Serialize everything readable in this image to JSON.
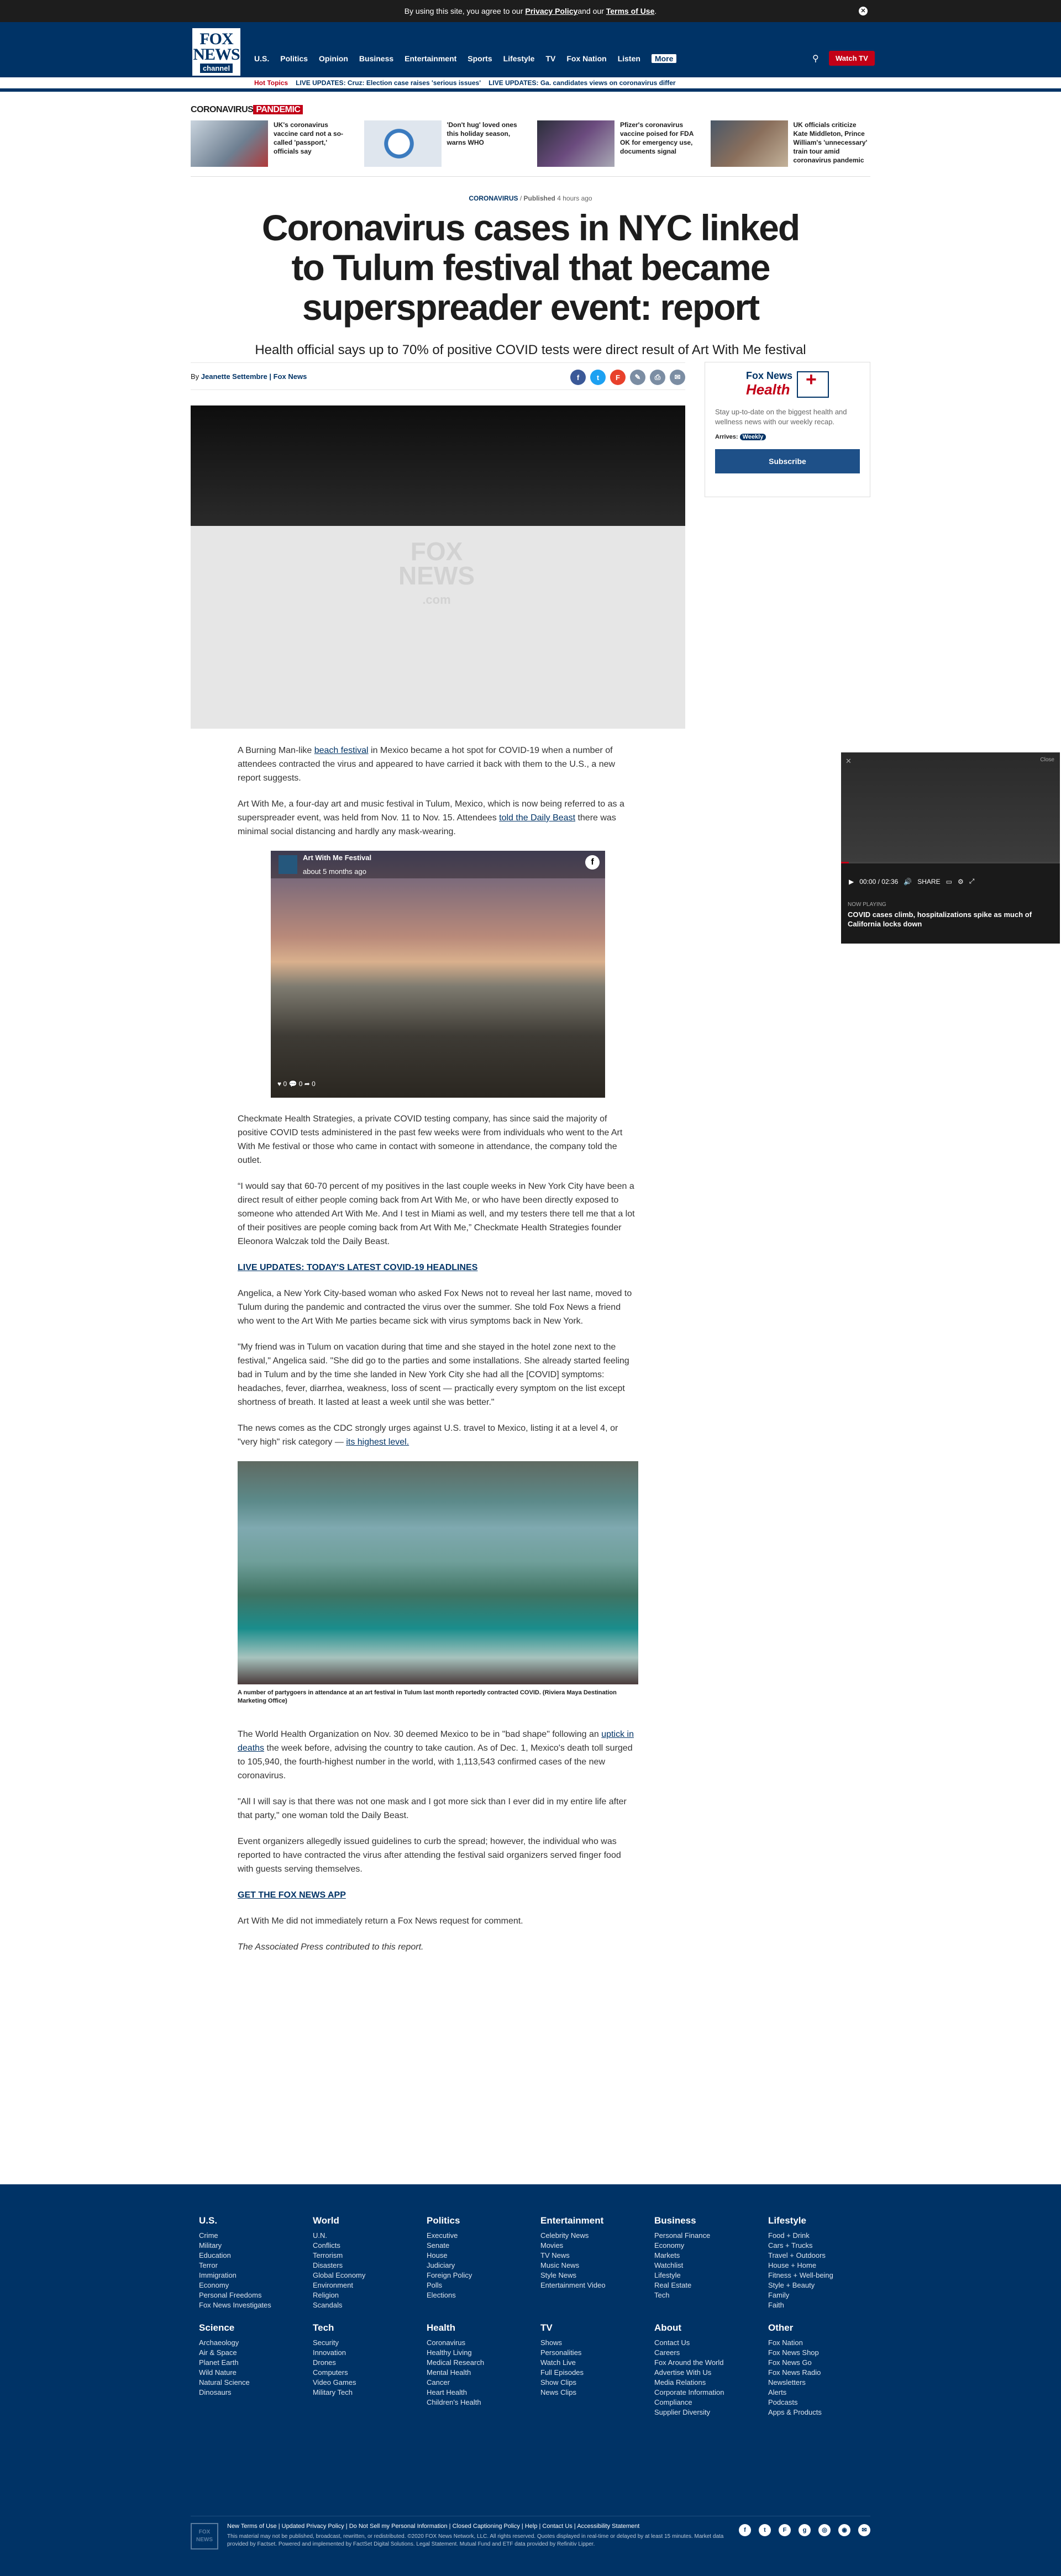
{
  "consent": {
    "prefix": "By using this site, you agree to our ",
    "privacy": "Privacy Policy",
    "and": " and our ",
    "terms": "Terms of Use",
    "dot": "."
  },
  "nav": {
    "logo_line1": "FOX",
    "logo_line2": "NEWS",
    "logo_line3": "channel",
    "items": [
      "U.S.",
      "Politics",
      "Opinion",
      "Business",
      "Entertainment",
      "Sports",
      "Lifestyle",
      "TV",
      "Fox Nation",
      "Listen",
      "More"
    ],
    "watch_tv": "Watch TV"
  },
  "hot": {
    "label": "Hot Topics",
    "h1": "LIVE UPDATES: Cruz: Election case raises 'serious issues'",
    "h2": "LIVE UPDATES: Ga. candidates views on coronavirus differ"
  },
  "topics": {
    "title": "CORONAVIRUS",
    "tag": "PANDEMIC",
    "cards": [
      {
        "text": "UK's coronavirus vaccine card not a so-called 'passport,' officials say"
      },
      {
        "text": "'Don't hug' loved ones this holiday season, warns WHO"
      },
      {
        "text": "Pfizer's coronavirus vaccine poised for FDA OK for emergency use, documents signal"
      },
      {
        "text": "UK officials criticize Kate Middleton, Prince William's 'unnecessary' train tour amid coronavirus pandemic"
      }
    ]
  },
  "article": {
    "section": "CORONAVIRUS",
    "sep": "/",
    "published": "Published",
    "time": "4 hours ago",
    "headline": "Coronavirus cases in NYC linked to Tulum festival that became superspreader event: report",
    "subhead": "Health official says up to 70% of positive COVID tests were direct result of Art With Me festival",
    "by": "By",
    "author": "Jeanette Settembre",
    "outlet": "| Fox News",
    "p1a": "A Burning Man-like ",
    "p1link": "beach festival",
    "p1b": " in Mexico became a hot spot for COVID-19 when a number of attendees contracted the virus and appeared to have carried it back with them to the U.S., a new report suggests.",
    "p2a": "Art With Me, a four-day art and music festival in Tulum, Mexico, which is now being referred to as a superspreader event, was held from Nov. 11 to Nov. 15. Attendees ",
    "p2link": "told the Daily Beast",
    "p2b": " there was minimal social distancing and hardly any mask-wearing.",
    "embed_name": "Art With Me Festival",
    "embed_time": "about 5 months ago",
    "embed_foot": "♥ 0   💬 0   ➦ 0",
    "p3": "Checkmate Health Strategies, a private COVID testing company, has since said the majority of positive COVID tests administered in the past few weeks were from individuals who went to the Art With Me festival or those who came in contact with someone in attendance, the company told the outlet.",
    "p4": "“I would say that 60-70 percent of my positives in the last couple weeks in New York City have been a direct result of either people coming back from Art With Me, or who have been directly exposed to someone who attended Art With Me. And I test in Miami as well, and my testers there tell me that a lot of their positives are people coming back from Art With Me,” Checkmate Health Strategies founder Eleonora Walczak told the Daily Beast.",
    "live_link": "LIVE UPDATES: TODAY'S LATEST COVID-19 HEADLINES",
    "p5": "Angelica, a New York City-based woman who asked Fox News not to reveal her last name, moved to Tulum during the pandemic and contracted the virus over the summer. She told Fox News a friend who went to the Art With Me parties became sick with virus symptoms back in New York.",
    "p6": "\"My friend was in Tulum on vacation during that time and she stayed in the hotel zone next to the festival,\" Angelica said. \"She did go to the parties and some installations. She already started feeling bad in Tulum and by the time she landed in New York City she had all the [COVID] symptoms: headaches, fever, diarrhea, weakness, loss of scent — practically every symptom on the list except shortness of breath. It lasted at least a week until she was better.\"",
    "p7a": "The news comes as the CDC strongly urges against U.S. travel to Mexico, listing it at a level 4, or \"very high\" risk category — ",
    "p7link": "its highest level.",
    "caption": "A number of partygoers in attendance at an art festival in Tulum last month reportedly contracted COVID.  (Riviera Maya Destination Marketing Office)",
    "p8a": "The World Health Organization on Nov. 30 deemed Mexico to be in \"bad shape\" following an ",
    "p8link": "uptick in deaths",
    "p8b": " the week before, advising the country to take caution. As of Dec. 1, Mexico's death toll surged to 105,940, the fourth-highest number in the world, with 1,113,543 confirmed cases of the new coronavirus.",
    "p9": "\"All I will say is that there was not one mask and I got more sick than I ever did in my entire life after that party,\" one woman told the Daily Beast.",
    "p10": "Event organizers allegedly issued guidelines to curb the spread; however, the individual who was reported to have contracted the virus after attending the festival said organizers served finger food with guests serving themselves.",
    "app_link": "GET THE FOX NEWS APP",
    "p11": "Art With Me did not immediately return a Fox News request for comment.",
    "p12": "The Associated Press contributed to this report."
  },
  "video": {
    "wm1": "FOX",
    "wm2": "NEWS",
    "wm3": ".com"
  },
  "sidebar": {
    "logo_a": "Fox News",
    "logo_b": "Health",
    "text": "Stay up-to-date on the biggest health and wellness news with our weekly recap.",
    "arrives": "Arrives:",
    "freq": "Weekly",
    "button": "Subscribe"
  },
  "floating": {
    "close": "Close",
    "time": "00:00 / 02:36",
    "share": "SHARE",
    "now_playing": "NOW PLAYING",
    "title": "COVID cases climb, hospitalizations spike as much of California locks down"
  },
  "footer": {
    "cols": [
      {
        "h": "U.S.",
        "items": [
          "Crime",
          "Military",
          "Education",
          "Terror",
          "Immigration",
          "Economy",
          "Personal Freedoms",
          "Fox News Investigates"
        ]
      },
      {
        "h": "World",
        "items": [
          "U.N.",
          "Conflicts",
          "Terrorism",
          "Disasters",
          "Global Economy",
          "Environment",
          "Religion",
          "Scandals"
        ]
      },
      {
        "h": "Politics",
        "items": [
          "Executive",
          "Senate",
          "House",
          "Judiciary",
          "Foreign Policy",
          "Polls",
          "Elections"
        ]
      },
      {
        "h": "Entertainment",
        "items": [
          "Celebrity News",
          "Movies",
          "TV News",
          "Music News",
          "Style News",
          "Entertainment Video"
        ]
      },
      {
        "h": "Business",
        "items": [
          "Personal Finance",
          "Economy",
          "Markets",
          "Watchlist",
          "Lifestyle",
          "Real Estate",
          "Tech"
        ]
      },
      {
        "h": "Lifestyle",
        "items": [
          "Food + Drink",
          "Cars + Trucks",
          "Travel + Outdoors",
          "House + Home",
          "Fitness + Well-being",
          "Style + Beauty",
          "Family",
          "Faith"
        ]
      },
      {
        "h": "Science",
        "items": [
          "Archaeology",
          "Air & Space",
          "Planet Earth",
          "Wild Nature",
          "Natural Science",
          "Dinosaurs"
        ]
      },
      {
        "h": "Tech",
        "items": [
          "Security",
          "Innovation",
          "Drones",
          "Computers",
          "Video Games",
          "Military Tech"
        ]
      },
      {
        "h": "Health",
        "items": [
          "Coronavirus",
          "Healthy Living",
          "Medical Research",
          "Mental Health",
          "Cancer",
          "Heart Health",
          "Children's Health"
        ]
      },
      {
        "h": "TV",
        "items": [
          "Shows",
          "Personalities",
          "Watch Live",
          "Full Episodes",
          "Show Clips",
          "News Clips"
        ]
      },
      {
        "h": "About",
        "items": [
          "Contact Us",
          "Careers",
          "Fox Around the World",
          "Advertise With Us",
          "Media Relations",
          "Corporate Information",
          "Compliance",
          "Supplier Diversity"
        ]
      },
      {
        "h": "Other",
        "items": [
          "Fox Nation",
          "Fox News Shop",
          "Fox News Go",
          "Fox News Radio",
          "Newsletters",
          "Alerts",
          "Podcasts",
          "Apps & Products"
        ]
      }
    ],
    "logo": "FOX NEWS",
    "links": "New Terms of Use  |  Updated Privacy Policy  |  Do Not Sell my Personal Information  |  Closed Captioning Policy  |  Help  |  Contact Us  |  Accessibility Statement",
    "legal": "This material may not be published, broadcast, rewritten, or redistributed. ©2020 FOX News Network, LLC. All rights reserved. Quotes displayed in real-time or delayed by at least 15 minutes. Market data provided by Factset. Powered and implemented by FactSet Digital Solutions. Legal Statement. Mutual Fund and ETF data provided by Refinitiv Lipper."
  }
}
